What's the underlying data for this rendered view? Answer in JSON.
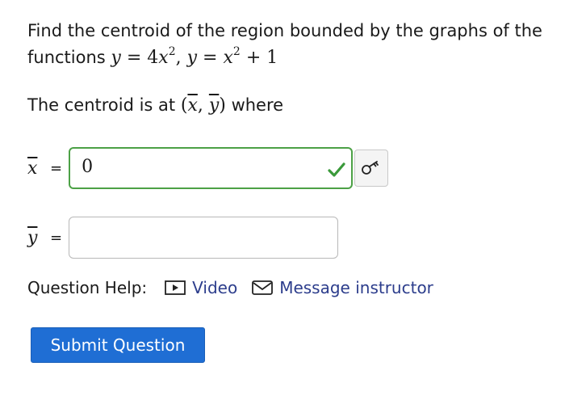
{
  "problem": {
    "text": "Find the centroid of the region bounded by the graphs of the functions",
    "f1_lhs": "y",
    "f1_eq": " = 4",
    "f1_var": "x",
    "f1_exp": "2",
    "sep": ", ",
    "f2_lhs": "y",
    "f2_eq": " = ",
    "f2_var": "x",
    "f2_exp": "2",
    "f2_rest": " + 1"
  },
  "centroid": {
    "prefix": "The centroid is at ",
    "open": "(",
    "xbar": "x",
    "comma": ", ",
    "ybar": "y",
    "close": ")",
    "suffix": " where"
  },
  "xbar_row": {
    "label": "x",
    "eq": "=",
    "value": "0",
    "status": "correct"
  },
  "ybar_row": {
    "label": "y",
    "eq": "=",
    "value": ""
  },
  "help": {
    "label": "Question Help:",
    "video": "Video",
    "message": "Message instructor"
  },
  "submit": {
    "label": "Submit Question"
  },
  "icons": {
    "check": "check-icon",
    "key": "key-icon",
    "video": "video-play-icon",
    "message": "envelope-icon"
  },
  "colors": {
    "correct_border": "#4ca146",
    "link": "#2c3d8c",
    "submit_bg": "#1f6ed4"
  }
}
